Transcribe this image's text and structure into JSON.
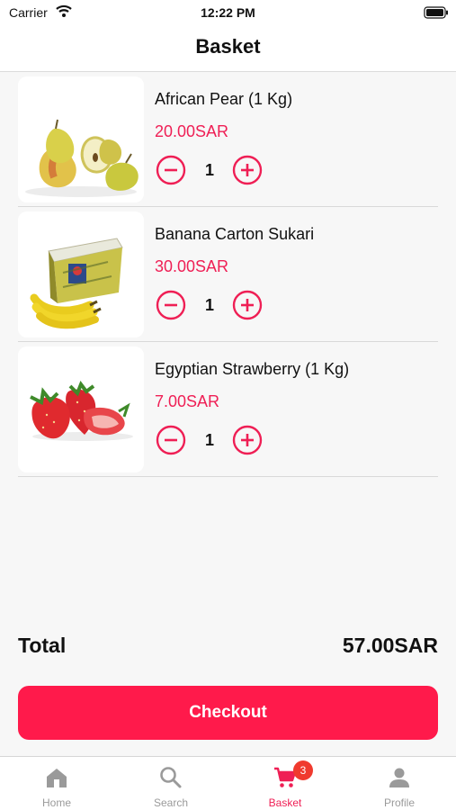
{
  "status_bar": {
    "carrier": "Carrier",
    "time": "12:22 PM"
  },
  "nav": {
    "title": "Basket"
  },
  "items": [
    {
      "name": "African Pear (1 Kg)",
      "price": "20.00SAR",
      "quantity": "1",
      "image": "pears"
    },
    {
      "name": "Banana Carton Sukari",
      "price": "30.00SAR",
      "quantity": "1",
      "image": "banana-carton"
    },
    {
      "name": "Egyptian Strawberry (1 Kg)",
      "price": "7.00SAR",
      "quantity": "1",
      "image": "strawberries"
    }
  ],
  "summary": {
    "total_label": "Total",
    "total_value": "57.00SAR"
  },
  "checkout": {
    "label": "Checkout"
  },
  "tabs": [
    {
      "label": "Home",
      "icon": "home-icon"
    },
    {
      "label": "Search",
      "icon": "search-icon"
    },
    {
      "label": "Basket",
      "icon": "cart-icon",
      "badge": "3",
      "active": true
    },
    {
      "label": "Profile",
      "icon": "person-icon"
    }
  ],
  "colors": {
    "accent": "#ef1f55",
    "checkout_bg": "#ff1a4b",
    "badge": "#f03a2e",
    "inactive": "#9a9a9a"
  }
}
